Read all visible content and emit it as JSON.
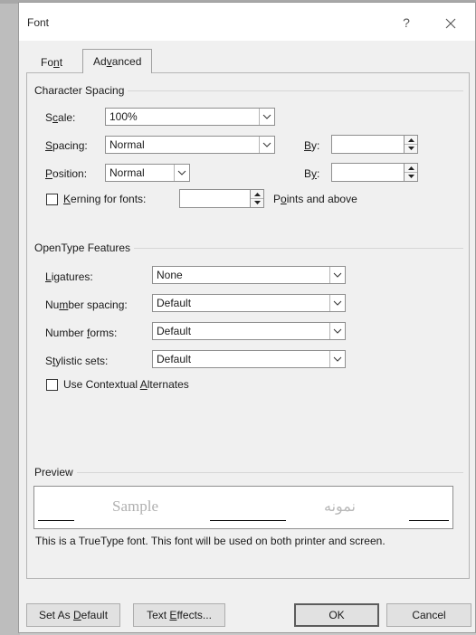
{
  "window": {
    "title": "Font",
    "help_glyph": "?",
    "close_glyph": "✕"
  },
  "tabs": [
    {
      "label": "Font",
      "accel": "n",
      "selected": false
    },
    {
      "label": "Advanced",
      "accel": "v",
      "selected": true
    }
  ],
  "character_spacing": {
    "heading": "Character Spacing",
    "scale": {
      "label": "Scale:",
      "value": "100%"
    },
    "spacing": {
      "label": "Spacing:",
      "value": "Normal",
      "by_label": "By:",
      "by_value": ""
    },
    "position": {
      "label": "Position:",
      "value": "Normal",
      "by_label": "By:",
      "by_value": ""
    },
    "kerning": {
      "label": "Kerning for fonts:",
      "checked": false,
      "value": "",
      "suffix": "Points and above"
    }
  },
  "opentype": {
    "heading": "OpenType Features",
    "ligatures": {
      "label": "Ligatures:",
      "value": "None"
    },
    "number_spacing": {
      "label": "Number spacing:",
      "value": "Default"
    },
    "number_forms": {
      "label": "Number forms:",
      "value": "Default"
    },
    "stylistic_sets": {
      "label": "Stylistic sets:",
      "value": "Default"
    },
    "contextual": {
      "label": "Use Contextual Alternates",
      "checked": false
    }
  },
  "preview": {
    "heading": "Preview",
    "sample_text": "Sample",
    "sample_text_rtl": "نمونه",
    "description": "This is a TrueType font. This font will be used on both printer and screen."
  },
  "buttons": {
    "set_default": "Set As Default",
    "text_effects": "Text Effects...",
    "ok": "OK",
    "cancel": "Cancel"
  }
}
